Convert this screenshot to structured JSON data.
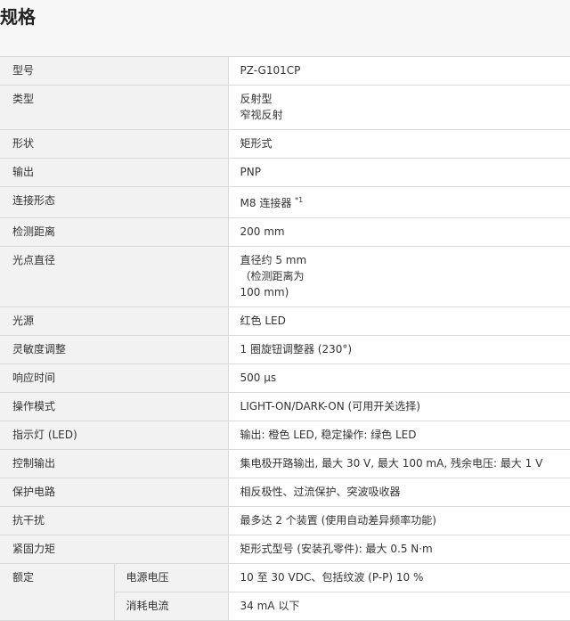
{
  "title": "规格",
  "rows": [
    {
      "label": "型号",
      "value": [
        "PZ-G101CP"
      ]
    },
    {
      "label": "类型",
      "value": [
        "反射型",
        "窄视反射"
      ]
    },
    {
      "label": "形状",
      "value": [
        "矩形式"
      ]
    },
    {
      "label": "输出",
      "value": [
        "PNP"
      ]
    },
    {
      "label": "连接形态",
      "value": [
        "M8 连接器 "
      ],
      "sup": "*1"
    },
    {
      "label": "检测距离",
      "value": [
        "200 mm"
      ]
    },
    {
      "label": "光点直径",
      "value": [
        "直径约 5 mm",
        "（检测距离为",
        "100 mm)"
      ]
    },
    {
      "label": "光源",
      "value": [
        "红色 LED"
      ]
    },
    {
      "label": "灵敏度调整",
      "value": [
        "1 圈旋钮调整器 (230°)"
      ]
    },
    {
      "label": "响应时间",
      "value": [
        "500 µs"
      ]
    },
    {
      "label": "操作模式",
      "value": [
        "LIGHT-ON/DARK-ON (可用开关选择)"
      ]
    },
    {
      "label": "指示灯 (LED)",
      "value": [
        "输出: 橙色 LED, 稳定操作: 绿色 LED"
      ]
    },
    {
      "label": "控制输出",
      "value": [
        "集电极开路输出, 最大 30 V, 最大 100 mA, 残余电压: 最大 1 V"
      ]
    },
    {
      "label": "保护电路",
      "value": [
        "相反极性、过流保护、突波吸收器"
      ]
    },
    {
      "label": "抗干扰",
      "value": [
        "最多达 2 个装置 (使用自动差异频率功能)"
      ]
    },
    {
      "label": "紧固力矩",
      "value": [
        "矩形式型号 (安装孔零件): 最大 0.5 N·m"
      ]
    }
  ],
  "rating": {
    "label": "额定",
    "items": [
      {
        "label": "电源电压",
        "value": "10 至 30 VDC、包括纹波 (P-P) 10 %"
      },
      {
        "label": "消耗电流",
        "value": "34 mA 以下"
      }
    ]
  }
}
